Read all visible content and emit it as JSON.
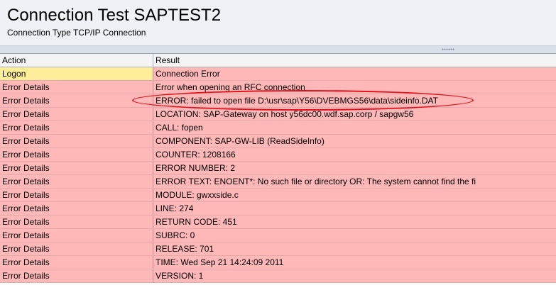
{
  "header": {
    "title": "Connection Test SAPTEST2",
    "subtitle": "Connection Type TCP/IP Connection"
  },
  "table": {
    "columns": [
      "Action",
      "Result"
    ],
    "rows": [
      {
        "action": "Logon",
        "result": "Connection Error"
      },
      {
        "action": "Error Details",
        "result": "Error when opening an RFC connection"
      },
      {
        "action": "Error Details",
        "result": "ERROR: failed to open file D:\\usr\\sap\\Y56\\DVEBMGS56\\data\\sideinfo.DAT"
      },
      {
        "action": "Error Details",
        "result": "LOCATION: SAP-Gateway on host y56dc00.wdf.sap.corp / sapgw56"
      },
      {
        "action": "Error Details",
        "result": "CALL: fopen"
      },
      {
        "action": "Error Details",
        "result": "COMPONENT: SAP-GW-LIB (ReadSideInfo)"
      },
      {
        "action": "Error Details",
        "result": "COUNTER: 1208166"
      },
      {
        "action": "Error Details",
        "result": "ERROR NUMBER: 2"
      },
      {
        "action": "Error Details",
        "result": "ERROR TEXT: ENOENT*: No such file or directory OR: The system cannot find the fi"
      },
      {
        "action": "Error Details",
        "result": "MODULE: gwxxside.c"
      },
      {
        "action": "Error Details",
        "result": "LINE: 274"
      },
      {
        "action": "Error Details",
        "result": "RETURN CODE: 451"
      },
      {
        "action": "Error Details",
        "result": "SUBRC: 0"
      },
      {
        "action": "Error Details",
        "result": "RELEASE: 701"
      },
      {
        "action": "Error Details",
        "result": "TIME: Wed Sep 21 14:24:09 2011"
      },
      {
        "action": "Error Details",
        "result": "VERSION: 1"
      }
    ]
  },
  "colors": {
    "error_row": "#ffb8b8",
    "logon_cell": "#ffee99",
    "highlight_ellipse": "#e0101a"
  }
}
